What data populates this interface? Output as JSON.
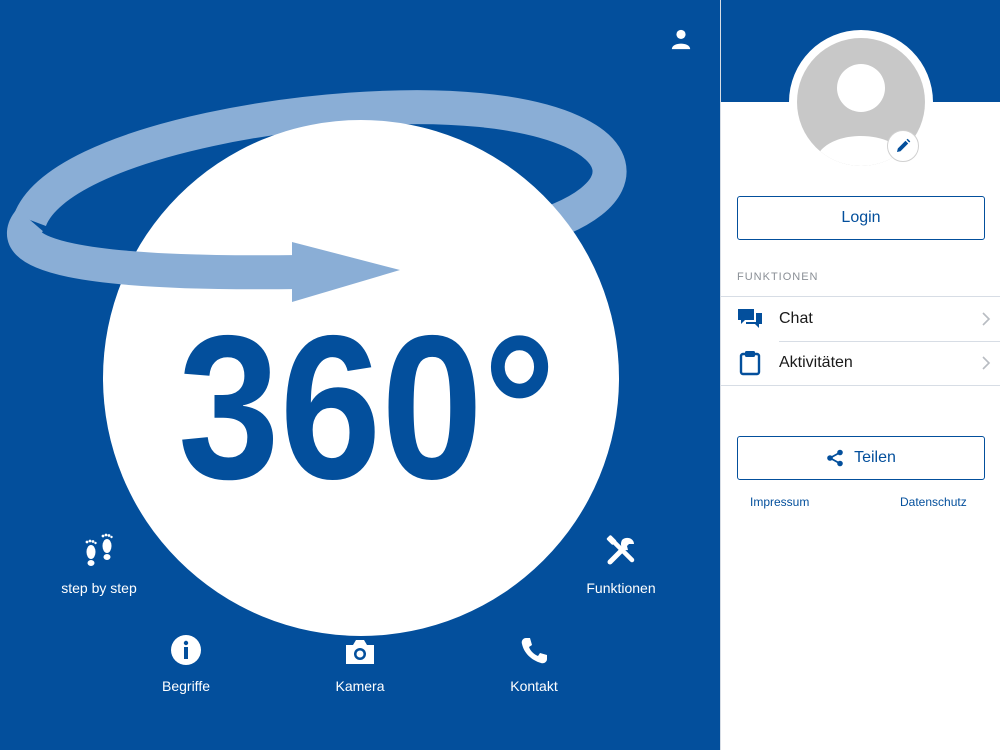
{
  "main": {
    "hero": {
      "text": "360°"
    },
    "nav": {
      "step_by_step": "step by step",
      "funktionen": "Funktionen",
      "begriffe": "Begriffe",
      "kamera": "Kamera",
      "kontakt": "Kontakt"
    }
  },
  "sidebar": {
    "login_label": "Login",
    "section_label": "FUNKTIONEN",
    "menu": [
      {
        "label": "Chat",
        "icon": "chat-icon"
      },
      {
        "label": "Aktivitäten",
        "icon": "clipboard-icon"
      }
    ],
    "share_label": "Teilen",
    "footer": {
      "impressum": "Impressum",
      "datenschutz": "Datenschutz"
    }
  },
  "colors": {
    "brand_blue": "#034f9c",
    "ring_blue": "#8aaed6",
    "white": "#ffffff",
    "avatar_gray": "#c8c8c8"
  }
}
